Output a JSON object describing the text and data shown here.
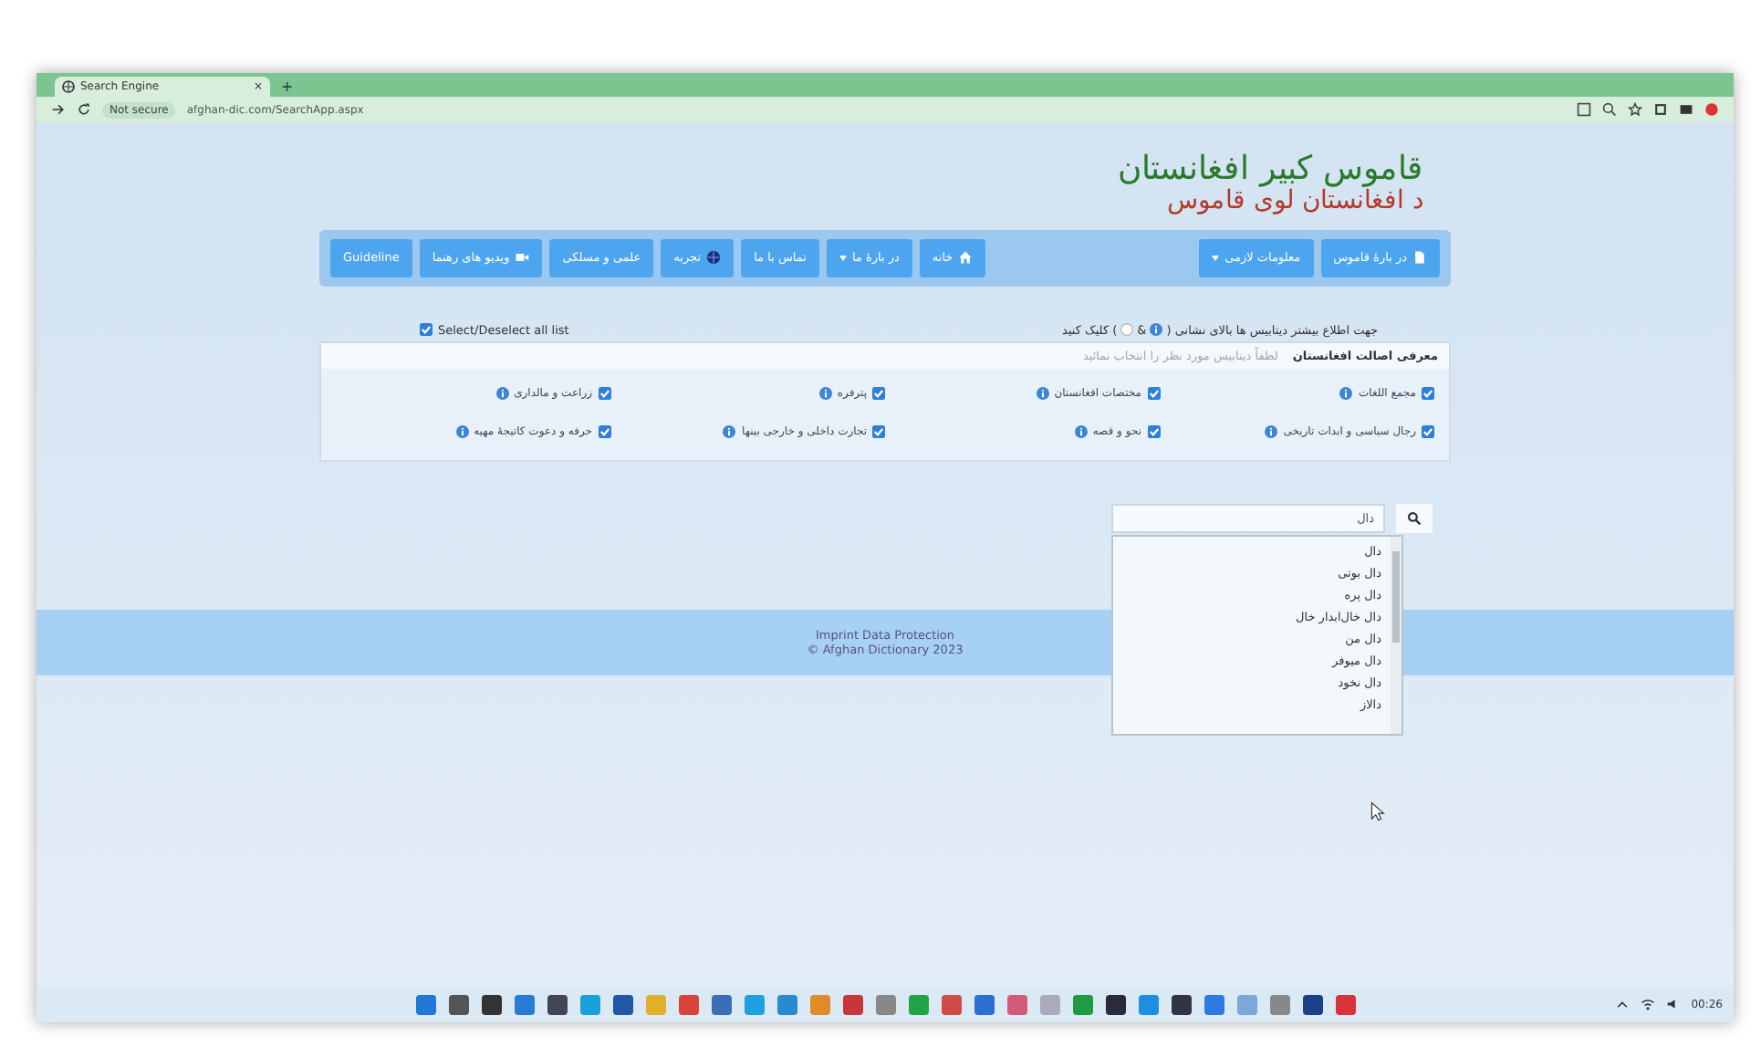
{
  "browser": {
    "tab_title": "Search Engine",
    "tab_close": "×",
    "new_tab": "+",
    "security": "Not secure",
    "url": "afghan-dic.com/SearchApp.aspx"
  },
  "logo": {
    "line1": "قاموس کبیر افغانستان",
    "line2": "د افغانستان لوی قاموس"
  },
  "nav": {
    "right_items": [
      {
        "label": "در بارهٔ قاموس",
        "kind": "doc",
        "dropdown": false
      },
      {
        "label": "معلومات لازمی",
        "kind": "plain",
        "dropdown": true
      }
    ],
    "left_items": [
      {
        "label": "خانه",
        "kind": "home",
        "dropdown": false
      },
      {
        "label": "در بارهٔ ما",
        "kind": "plain",
        "dropdown": true
      },
      {
        "label": "تماس با ما",
        "kind": "plain",
        "dropdown": false
      },
      {
        "label": "تجربه",
        "kind": "globe",
        "dropdown": false
      },
      {
        "label": "علمی و مسلکی",
        "kind": "plain",
        "dropdown": false
      },
      {
        "label": "ویدیو های رهنما",
        "kind": "video",
        "dropdown": false
      },
      {
        "label": "Guideline",
        "kind": "plain",
        "dropdown": false
      }
    ]
  },
  "info": {
    "text_start": "جهت اطلاع بیشتر دیتابیس ها بالای نشانی (",
    "ampersand": "&",
    "text_end": ") کلیک کنید"
  },
  "select_all": {
    "label": "Select/Deselect all list",
    "checked": true
  },
  "panel": {
    "title": "معرفی اصالت افغانستان",
    "hint": "لطفاً دیتابیس مورد نظر را انتخاب نمائید",
    "items": [
      {
        "label": "مجمع اللغات",
        "checked": true
      },
      {
        "label": "مختصات افغانستان",
        "checked": true
      },
      {
        "label": "پترفره",
        "checked": true
      },
      {
        "label": "زراعت و مالداری",
        "checked": true
      },
      {
        "label": "رجال سیاسی و ابدات تاریخی",
        "checked": true
      },
      {
        "label": "نحو و قصه",
        "checked": true
      },
      {
        "label": "تجارت داخلی و خارجی بینها",
        "checked": true
      },
      {
        "label": "حرفه و دعوت کاتیجهٔ مهیه",
        "checked": true
      }
    ]
  },
  "search": {
    "value": "دال",
    "suggestions": [
      "دال",
      "دال بوتی",
      "دال پره",
      "دال خال‌ابدار خال",
      "دال من",
      "دال میوفر",
      "دال نخود",
      "دالاز"
    ]
  },
  "footer": {
    "line1": "Imprint Data Protection",
    "line2": "© Afghan Dictionary 2023"
  },
  "taskbar": {
    "time": "00:26"
  }
}
